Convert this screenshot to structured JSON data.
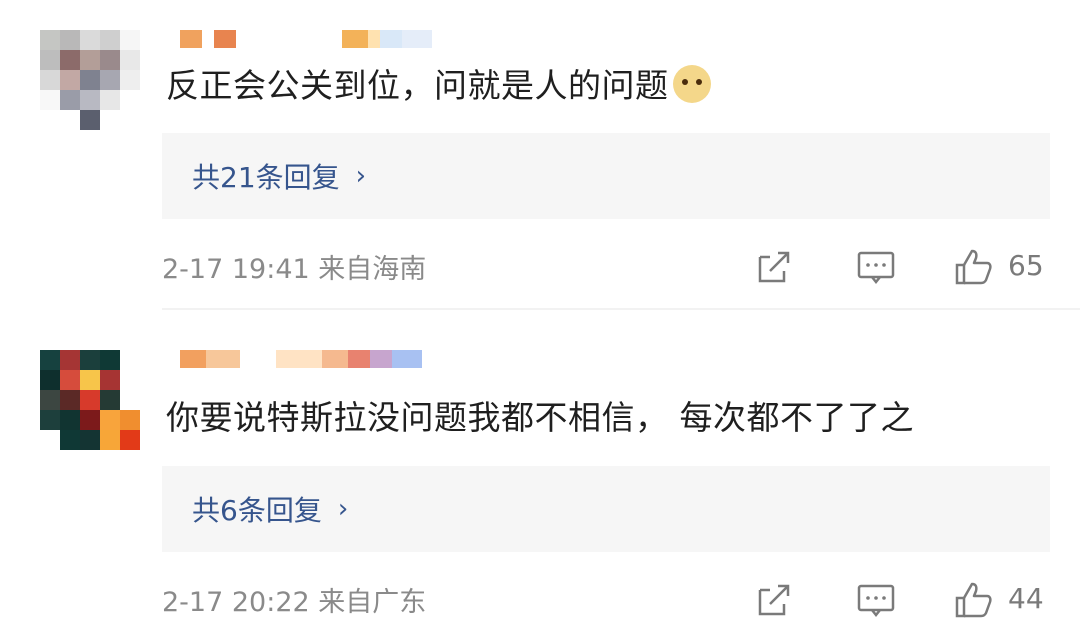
{
  "comments": [
    {
      "text": "反正会公关到位，问就是人的问题",
      "emoji": "doge-emoji",
      "replies_label": "共21条回复",
      "meta": "2-17 19:41 来自海南",
      "likes": "65",
      "avatar_colors": [
        "#c5c6c3",
        "#b9b8b8",
        "#dadada",
        "#cfcfcf",
        "#f6f6f6",
        "#bdbdbd",
        "#8c6b6a",
        "#b39e98",
        "#9a8a8c",
        "#e8e8e8",
        "#d8d8d8",
        "#c2a8a4",
        "#7f8290",
        "#a7a7b1",
        "#eeeeee",
        "#f8f8f8",
        "#9a9ca8",
        "#b8b9c2",
        "#e7e7e7",
        "#ffffff",
        "#ffffff",
        "#ffffff",
        "#5b5f6e",
        "#ffffff",
        "#ffffff"
      ],
      "username_colors": [
        "#f0a25e",
        "#ffffff",
        "#e8844f",
        "#ffffff",
        "#ffffff",
        "#ffffff",
        "#f3b259",
        "#ffe2b0",
        "#d9e8f8",
        "#e5edf9"
      ]
    },
    {
      "text": "你要说特斯拉没问题我都不相信， 每次都不了了之",
      "replies_label": "共6条回复",
      "meta": "2-17 20:22 来自广东",
      "likes": "44",
      "avatar_colors": [
        "#16413f",
        "#a53534",
        "#1b3f3c",
        "#0f3935",
        "#ffffff",
        "#0e2f2d",
        "#d64c3c",
        "#f7c54a",
        "#a63433",
        "#ffffff",
        "#3c4641",
        "#5b2926",
        "#d73a2b",
        "#253a34",
        "#ffffff",
        "#1d3f3c",
        "#113431",
        "#7c1a1b",
        "#f8a43c",
        "#f08e2f",
        "#ffffff",
        "#0f3835",
        "#143433",
        "#f7a638",
        "#e23a18"
      ],
      "username_colors": [
        "#f2a05f",
        "#f7c79a",
        "#ffffff",
        "#ffe3c4",
        "#f5b98f",
        "#e8826f",
        "#c7a5ce",
        "#a8c1f2"
      ]
    }
  ],
  "colors": {
    "reply_link": "#36558d",
    "meta_text": "#8a8a8a",
    "reply_box_bg": "#f6f6f6"
  }
}
